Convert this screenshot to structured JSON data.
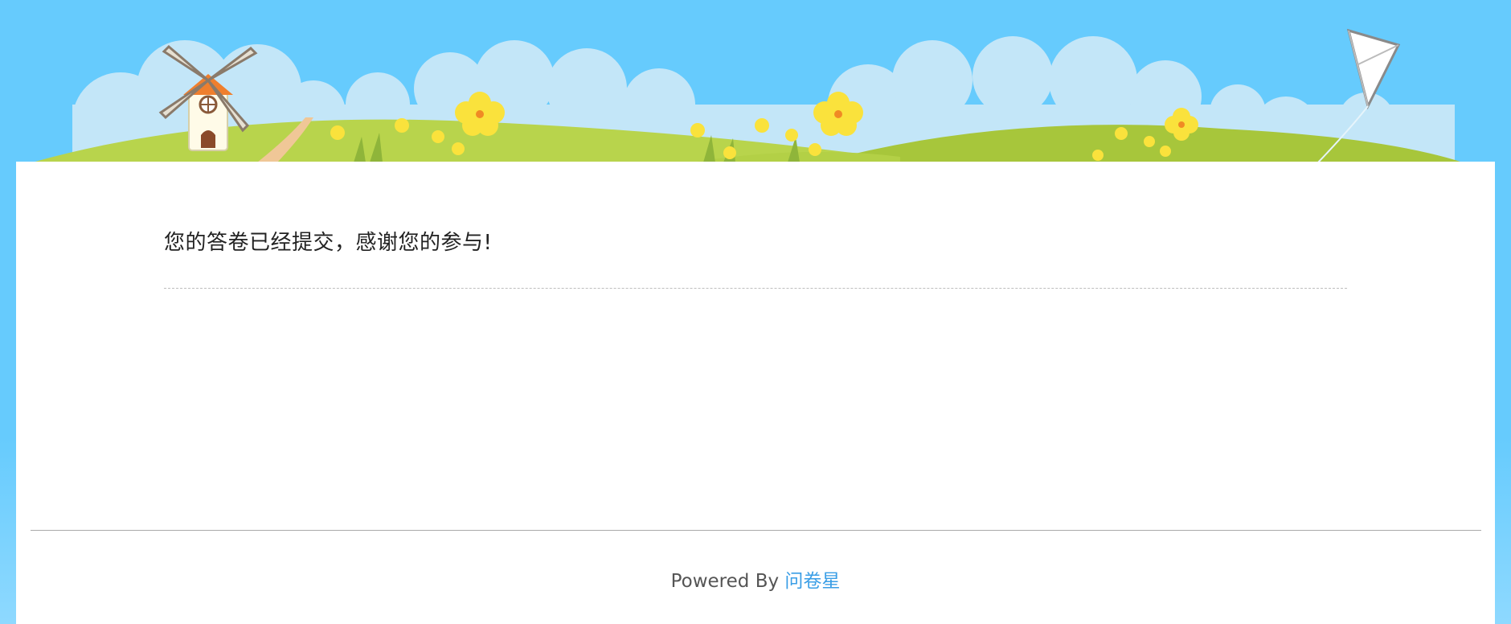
{
  "confirmation": {
    "message": "您的答卷已经提交，感谢您的参与!"
  },
  "footer": {
    "powered_by": "Powered By",
    "brand": "问卷星"
  },
  "banner": {
    "scene": [
      "windmill-icon",
      "kite-icon",
      "flower-icon",
      "cloud-icon",
      "hill-icon"
    ]
  },
  "colors": {
    "sky": "#66cbfd",
    "cloud": "#c3e6f8",
    "hill": "#b8d44c",
    "link": "#3a9ee6"
  }
}
